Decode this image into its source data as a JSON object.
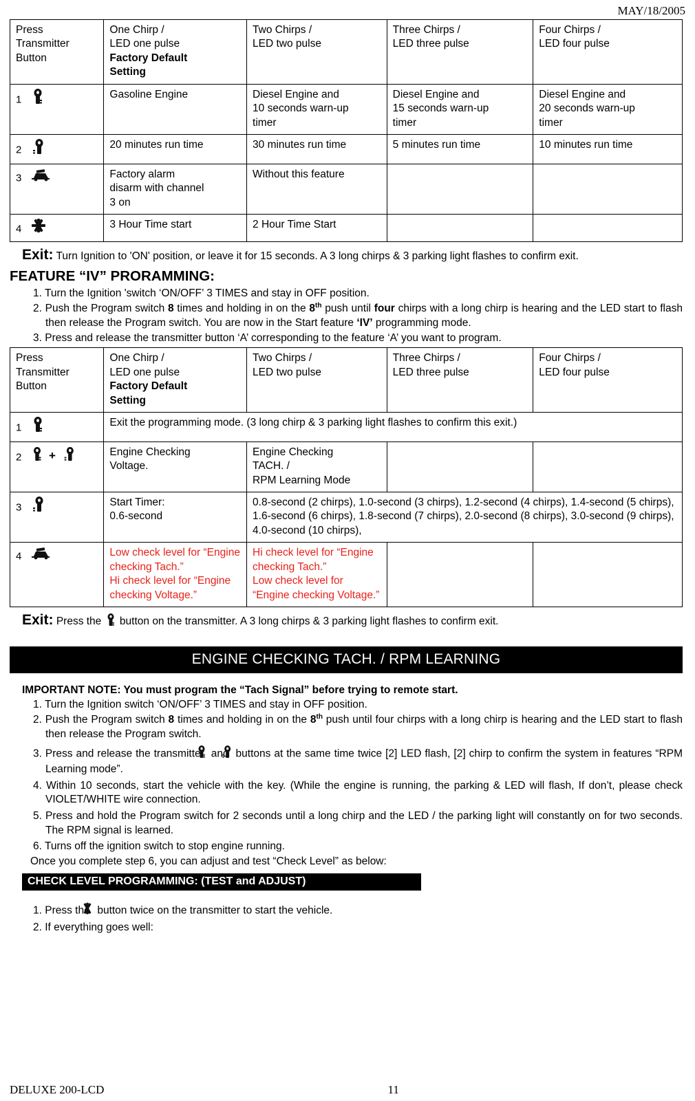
{
  "header": {
    "date": "MAY/18/2005"
  },
  "table1": {
    "headers": [
      "Press\nTransmitter\nButton",
      "One Chirp /\nLED one pulse",
      "Factory Default\nSetting",
      "Two Chirps /\nLED two pulse",
      "Three Chirps /\nLED three pulse",
      "Four Chirps /\nLED four pulse"
    ],
    "col1_head": "Press",
    "col1_head2": "Transmitter",
    "col1_head3": "Button",
    "col2_head_a": "One Chirp /",
    "col2_head_b": "LED one pulse",
    "col2_head_c": "Factory Default",
    "col2_head_d": "Setting",
    "col3_head_a": "Two Chirps /",
    "col3_head_b": "LED two pulse",
    "col4_head_a": "Three Chirps /",
    "col4_head_b": "LED three pulse",
    "col5_head_a": "Four Chirps /",
    "col5_head_b": "LED four pulse",
    "rows": [
      {
        "num": "1",
        "icon": "lock-key-icon",
        "c2": "Gasoline Engine",
        "c3": "Diesel Engine and\n10 seconds warn-up\ntimer",
        "c4": "Diesel Engine and\n15 seconds warn-up\ntimer",
        "c5": "Diesel Engine and\n20 seconds warn-up\ntimer"
      },
      {
        "num": "2",
        "icon": "unlock-key-icon",
        "c2": "20 minutes run time",
        "c3": "30 minutes run time",
        "c4": "5 minutes run time",
        "c5": "10 minutes run time"
      },
      {
        "num": "3",
        "icon": "trunk-car-icon",
        "c2": "Factory alarm\ndisarm with channel\n3 on",
        "c3": "Without this feature",
        "c4": "",
        "c5": ""
      },
      {
        "num": "4",
        "icon": "star-remote-start-icon",
        "c2": "3 Hour Time start",
        "c3": "2 Hour Time Start",
        "c4": "",
        "c5": ""
      }
    ]
  },
  "exit1": {
    "label": "Exit:",
    "text": " Turn Ignition to 'ON' position, or leave it for 15 seconds. A 3 long chirps & 3 parking light flashes to confirm exit."
  },
  "feature4": {
    "heading": "FEATURE “IV” PRORAMMING:",
    "step1": "1. Turn the Ignition 'switch ‘ON/OFF’ 3 TIMES and stay in OFF position.",
    "step2_a": "2. Push the Program switch ",
    "step2_b": "8",
    "step2_c": " times and holding in on the ",
    "step2_d": "8",
    "step2_sup": "th",
    "step2_e": " push until ",
    "step2_f": "four",
    "step2_g": " chirps with a long chirp is hearing and the LED start to flash then release the Program switch. You are now in the Start feature ",
    "step2_h": "‘IV’",
    "step2_i": " programming mode.",
    "step3": "3. Press and release the transmitter button ‘A’ corresponding to the feature ‘A’ you want to program."
  },
  "table2": {
    "col1_head": "Press",
    "col1_head2": "Transmitter",
    "col1_head3": "Button",
    "col2_head_a": "One Chirp /",
    "col2_head_b": "LED one pulse",
    "col2_head_c": "Factory Default",
    "col2_head_d": "Setting",
    "col3_head_a": "Two Chirps /",
    "col3_head_b": "LED two pulse",
    "col4_head_a": "Three Chirps /",
    "col4_head_b": "LED three pulse",
    "col5_head_a": "Four Chirps /",
    "col5_head_b": "LED four pulse",
    "row1": {
      "num": "1",
      "icon": "lock-key-icon",
      "text": "Exit the programming mode. (3 long chirp & 3 parking light flashes to confirm this exit.)"
    },
    "row2": {
      "num": "2",
      "icon_a": "lock-key-icon",
      "plus": "+",
      "icon_b": "unlock-key-icon",
      "c2": "Engine Checking\nVoltage.",
      "c3": "Engine Checking\nTACH. /\nRPM Learning Mode",
      "c4": "",
      "c5": ""
    },
    "row3": {
      "num": "3",
      "icon": "unlock-key-icon",
      "c2": "Start Timer:\n0.6-second",
      "c3": "0.8-second (2 chirps), 1.0-second (3 chirps), 1.2-second (4 chirps), 1.4-second (5 chirps), 1.6-second (6 chirps), 1.8-second (7 chirps), 2.0-second (8 chirps), 3.0-second (9 chirps), 4.0-second (10 chirps),"
    },
    "row4": {
      "num": "4",
      "icon": "trunk-car-icon",
      "c2": "Low check level for “Engine checking Tach.”\nHi check level for “Engine checking Voltage.”",
      "c3": "Hi check level for “Engine checking Tach.”\nLow check level for “Engine checking Voltage.”",
      "c4": "",
      "c5": ""
    }
  },
  "exit2": {
    "label": "Exit:",
    "text_a": " Press the ",
    "icon": "lock-key-icon",
    "text_b": " button on the transmitter. A 3 long chirps & 3 parking light flashes to confirm exit."
  },
  "banner": {
    "title": "ENGINE CHECKING TACH. / RPM LEARNING"
  },
  "rpm": {
    "note": "IMPORTANT NOTE: You must program the “Tach Signal” before trying to remote start.",
    "step1": "1. Turn the Ignition switch ‘ON/OFF’ 3 TIMES and stay in OFF position.",
    "step2_a": "2. Push the Program switch ",
    "step2_b": "8",
    "step2_c": " times and holding in on the ",
    "step2_d": "8",
    "step2_sup": "th",
    "step2_e": " push until four chirps with a long chirp is hearing and the LED start to flash then release the Program switch.",
    "step3_a": "3. Press and release the transmitter ",
    "step3_icon_a": "lock-key-icon",
    "step3_b": " and ",
    "step3_icon_b": "unlock-key-icon",
    "step3_c": " buttons at the same time twice [2] LED flash, [2] chirp to confirm the system in features “RPM Learning mode”.",
    "step4": "4. Within 10 seconds, start the vehicle with the key. (While the engine is running, the parking & LED will flash, If don’t, please check VIOLET/WHITE wire connection.",
    "step5": "5. Press and hold the Program switch for 2 seconds until a long chirp and the LED / the parking light will constantly on for two seconds. The RPM signal is learned.",
    "step6": "6. Turns off the ignition switch to stop engine running.",
    "closing": "Once you complete step 6, you can adjust and test “Check Level” as below:",
    "sub_banner": "CHECK LEVEL PROGRAMMING: (TEST and ADJUST)",
    "check1_a": "1. Press the ",
    "check1_icon": "star-remote-start-icon",
    "check1_b": " button twice on the transmitter to start the vehicle.",
    "check2": "2. If everything goes well:"
  },
  "footer": {
    "left": "DELUXE 200-LCD",
    "page": "11"
  }
}
